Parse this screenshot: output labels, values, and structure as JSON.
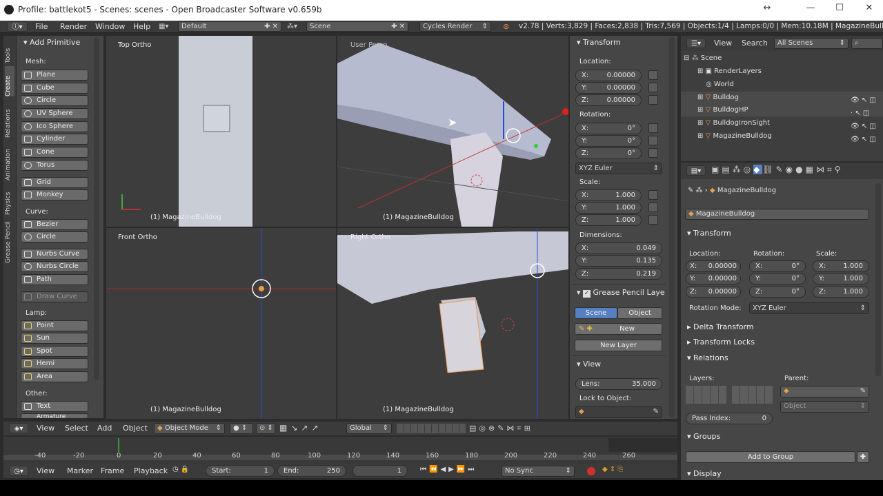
{
  "window": {
    "title": "Profile: battlekot5 - Scenes: scenes - Open Broadcaster Software v0.659b"
  },
  "info": {
    "menus": [
      "File",
      "Render",
      "Window",
      "Help"
    ],
    "layout": "Default",
    "scene": "Scene",
    "engine": "Cycles Render",
    "stats": "v2.78 | Verts:3,829 | Faces:2,838 | Tris:7,569 | Objects:1/4 | Lamps:0/0 | Mem:10.18M | MagazineBulldog"
  },
  "toolshelf": {
    "tabs": [
      "Tools",
      "Create",
      "Relations",
      "Animation",
      "Physics",
      "Grease Pencil"
    ],
    "title": "Add Primitive",
    "mesh_label": "Mesh:",
    "mesh": [
      "Plane",
      "Cube",
      "Circle",
      "UV Sphere",
      "Ico Sphere",
      "Cylinder",
      "Cone",
      "Torus",
      "Grid",
      "Monkey"
    ],
    "curve_label": "Curve:",
    "curve": [
      "Bezier",
      "Circle",
      "Nurbs Curve",
      "Nurbs Circle",
      "Path",
      "Draw Curve"
    ],
    "lamp_label": "Lamp:",
    "lamp": [
      "Point",
      "Sun",
      "Spot",
      "Hemi",
      "Area"
    ],
    "other_label": "Other:",
    "other": [
      "Text",
      "Armature"
    ]
  },
  "viewports": {
    "tl": {
      "name": "Top Ortho",
      "obj": "(1) MagazineBulldog"
    },
    "tr": {
      "name": "User Persp",
      "obj": "(1) MagazineBulldog"
    },
    "bl": {
      "name": "Front Ortho",
      "obj": "(1) MagazineBulldog"
    },
    "br": {
      "name": "Right Ortho",
      "obj": "(1) MagazineBulldog"
    }
  },
  "npanel": {
    "transform": "Transform",
    "location": "Location:",
    "loc": [
      [
        "X:",
        "0.00000"
      ],
      [
        "Y:",
        "0.00000"
      ],
      [
        "Z:",
        "0.00000"
      ]
    ],
    "rotation": "Rotation:",
    "rot": [
      [
        "X:",
        "0°"
      ],
      [
        "Y:",
        "0°"
      ],
      [
        "Z:",
        "0°"
      ]
    ],
    "rot_mode": "XYZ Euler",
    "scale": "Scale:",
    "scl": [
      [
        "X:",
        "1.000"
      ],
      [
        "Y:",
        "1.000"
      ],
      [
        "Z:",
        "1.000"
      ]
    ],
    "dimensions": "Dimensions:",
    "dim": [
      [
        "X:",
        "0.049"
      ],
      [
        "Y:",
        "0.135"
      ],
      [
        "Z:",
        "0.219"
      ]
    ],
    "grease": "Grease Pencil Laye",
    "scene_btn": "Scene",
    "object_btn": "Object",
    "new_btn": "New",
    "new_layer": "New Layer",
    "view": "View",
    "lens_label": "Lens:",
    "lens": "35.000",
    "lock_obj": "Lock to Object:"
  },
  "outliner": {
    "menus": [
      "View",
      "Search"
    ],
    "filter": "All Scenes",
    "items": [
      "Scene",
      "RenderLayers",
      "World",
      "Bulldog",
      "BulldogHP",
      "BulldogIronSight",
      "MagazineBulldog"
    ]
  },
  "props": {
    "breadcrumb": "MagazineBulldog",
    "name": "MagazineBulldog",
    "transform": "Transform",
    "loc_label": "Location:",
    "rot_label": "Rotation:",
    "scl_label": "Scale:",
    "loc": [
      [
        "X:",
        "0.00000"
      ],
      [
        "Y:",
        "0.00000"
      ],
      [
        "Z:",
        "0.00000"
      ]
    ],
    "rot": [
      [
        "X:",
        "0°"
      ],
      [
        "Y:",
        "0°"
      ],
      [
        "Z:",
        "0°"
      ]
    ],
    "scl": [
      [
        "X:",
        "1.000"
      ],
      [
        "Y:",
        "1.000"
      ],
      [
        "Z:",
        "1.000"
      ]
    ],
    "rot_mode_label": "Rotation Mode:",
    "rot_mode": "XYZ Euler",
    "delta": "Delta Transform",
    "locks": "Transform Locks",
    "relations": "Relations",
    "layers": "Layers:",
    "parent": "Parent:",
    "parent_type": "Object",
    "pass_label": "Pass Index:",
    "pass": "0",
    "groups": "Groups",
    "add_group": "Add to Group",
    "display": "Display"
  },
  "view3d_header": {
    "menus": [
      "View",
      "Select",
      "Add",
      "Object"
    ],
    "mode": "Object Mode",
    "orient": "Global"
  },
  "timeline": {
    "ticks": [
      "-40",
      "-20",
      "0",
      "20",
      "40",
      "60",
      "80",
      "100",
      "120",
      "140",
      "160",
      "180",
      "200",
      "220",
      "240",
      "260"
    ],
    "menus": [
      "View",
      "Marker",
      "Frame",
      "Playback"
    ],
    "start_label": "Start:",
    "start": "1",
    "end_label": "End:",
    "end": "250",
    "current": "1",
    "sync": "No Sync"
  }
}
